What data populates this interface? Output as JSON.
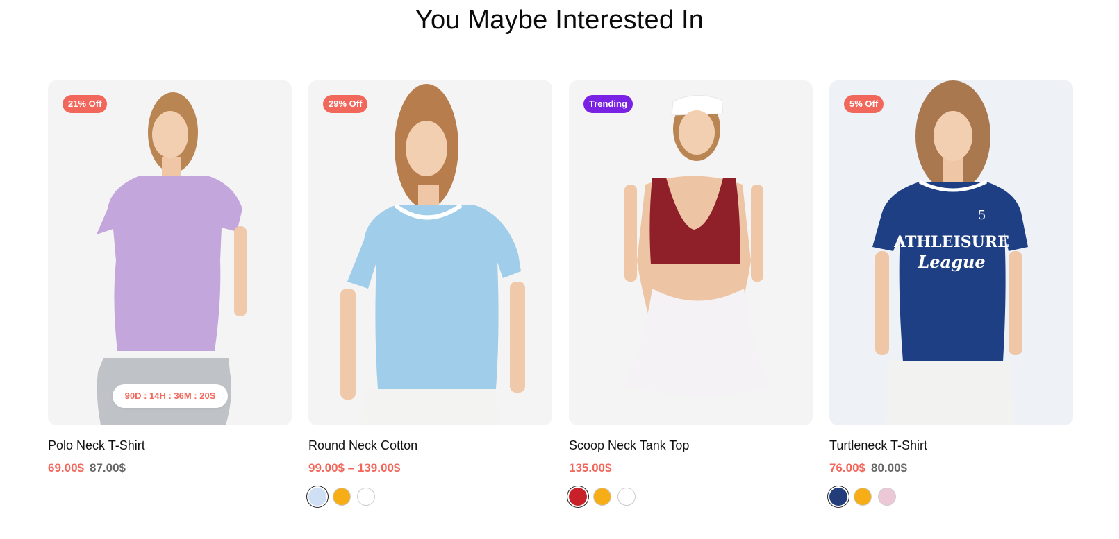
{
  "section": {
    "title": "You Maybe Interested In"
  },
  "products": [
    {
      "name": "Polo Neck T-Shirt",
      "badge": "21% Off",
      "badge_type": "sale",
      "price": "69.00$",
      "old_price": "87.00$",
      "countdown": "90D : 14H : 36M : 20S",
      "shirt_color": "#c3a6dc",
      "bottom_color": "#bfc2c6",
      "swatches": []
    },
    {
      "name": "Round Neck Cotton",
      "badge": "29% Off",
      "badge_type": "sale",
      "price": "99.00$ – 139.00$",
      "old_price": "",
      "shirt_color": "#9fcdea",
      "bottom_color": "#f3f3f1",
      "swatches": [
        {
          "color": "#cfe0f5",
          "active": true
        },
        {
          "color": "#f7ad15",
          "active": false
        },
        {
          "color": "#ffffff",
          "active": false
        }
      ]
    },
    {
      "name": "Scoop Neck Tank Top",
      "badge": "Trending",
      "badge_type": "trend",
      "price": "135.00$",
      "old_price": "",
      "shirt_color": "#8f1f28",
      "bottom_color": "#f4f2f5",
      "swatches": [
        {
          "color": "#c8212a",
          "active": true
        },
        {
          "color": "#f7ad15",
          "active": false
        },
        {
          "color": "#ffffff",
          "active": false
        }
      ]
    },
    {
      "name": "Turtleneck T-Shirt",
      "badge": "5% Off",
      "badge_type": "sale",
      "price": "76.00$",
      "old_price": "80.00$",
      "shirt_color": "#1f3f85",
      "bottom_color": "#f2f3f1",
      "print_text_1": "ATHLEISURE",
      "print_text_2": "League",
      "print_number": "5",
      "swatches": [
        {
          "color": "#233d7a",
          "active": true
        },
        {
          "color": "#f7ad15",
          "active": false
        },
        {
          "color": "#ecc8d6",
          "active": false
        }
      ]
    }
  ]
}
